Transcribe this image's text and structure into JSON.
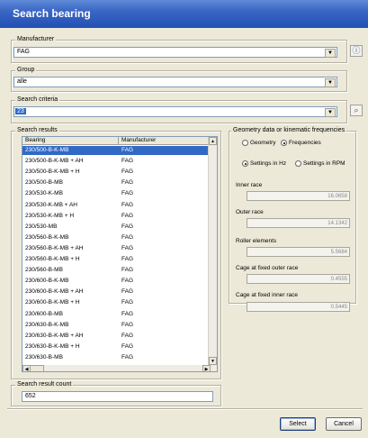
{
  "window": {
    "title": "Search bearing"
  },
  "manufacturer": {
    "label": "Manufacturer",
    "value": "FAG"
  },
  "group": {
    "label": "Group",
    "value": "alle"
  },
  "criteria": {
    "label": "Search criteria",
    "value": "23"
  },
  "results": {
    "label": "Search results",
    "columns": [
      "Bearing",
      "Manufacturer"
    ],
    "rows": [
      [
        "230/500-B-K-MB",
        "FAG"
      ],
      [
        "230/500-B-K-MB + AH",
        "FAG"
      ],
      [
        "230/500-B-K-MB + H",
        "FAG"
      ],
      [
        "230/500-B-MB",
        "FAG"
      ],
      [
        "230/530-K-MB",
        "FAG"
      ],
      [
        "230/530-K-MB + AH",
        "FAG"
      ],
      [
        "230/530-K-MB + H",
        "FAG"
      ],
      [
        "230/530-MB",
        "FAG"
      ],
      [
        "230/560-B-K-MB",
        "FAG"
      ],
      [
        "230/560-B-K-MB + AH",
        "FAG"
      ],
      [
        "230/560-B-K-MB + H",
        "FAG"
      ],
      [
        "230/560-B-MB",
        "FAG"
      ],
      [
        "230/600-B-K-MB",
        "FAG"
      ],
      [
        "230/600-B-K-MB + AH",
        "FAG"
      ],
      [
        "230/600-B-K-MB + H",
        "FAG"
      ],
      [
        "230/600-B-MB",
        "FAG"
      ],
      [
        "230/630-B-K-MB",
        "FAG"
      ],
      [
        "230/630-B-K-MB + AH",
        "FAG"
      ],
      [
        "230/630-B-K-MB + H",
        "FAG"
      ],
      [
        "230/630-B-MB",
        "FAG"
      ]
    ]
  },
  "count": {
    "label": "Search result count",
    "value": "652"
  },
  "geometry": {
    "label": "Geometry data or kinematic frequencies",
    "radio_geometry": "Geometry",
    "radio_frequencies": "Frequencies",
    "radio_hz": "Settings in Hz",
    "radio_rpm": "Settings in RPM",
    "inner_race": {
      "label": "Inner race",
      "value": "16.0658"
    },
    "outer_race": {
      "label": "Outer race",
      "value": "14.1342"
    },
    "roller": {
      "label": "Roller elements",
      "value": "5.5684"
    },
    "cage_outer": {
      "label": "Cage at fixed outer race",
      "value": "0.4555"
    },
    "cage_inner": {
      "label": "Cage at fixed inner race",
      "value": "0.5445"
    }
  },
  "buttons": {
    "select": "Select",
    "cancel": "Cancel"
  }
}
